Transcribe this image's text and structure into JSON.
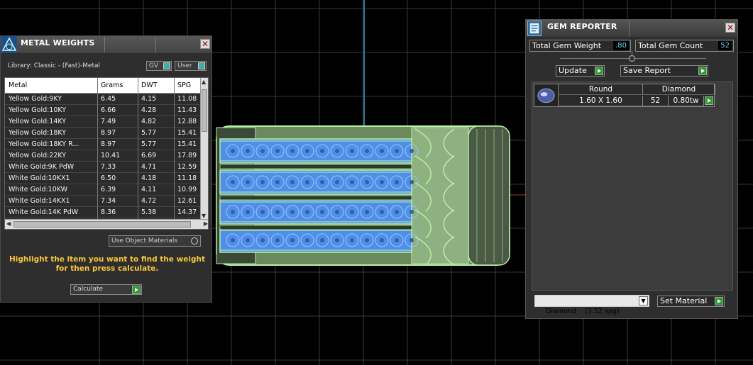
{
  "metal_weights": {
    "title": "METAL WEIGHTS",
    "library_label": "Library: Classic - (Fast)-Metal",
    "toggle_gv": "GV",
    "toggle_user": "User",
    "columns": [
      "Metal",
      "Grams",
      "DWT",
      "SPG"
    ],
    "rows": [
      [
        "Yellow Gold:9KY",
        "6.45",
        "4.15",
        "11.08"
      ],
      [
        "Yellow Gold:10KY",
        "6.66",
        "4.28",
        "11.43"
      ],
      [
        "Yellow Gold:14KY",
        "7.49",
        "4.82",
        "12.88"
      ],
      [
        "Yellow Gold:18KY",
        "8.97",
        "5.77",
        "15.41"
      ],
      [
        "Yellow Gold:18KY R...",
        "8.97",
        "5.77",
        "15.41"
      ],
      [
        "Yellow Gold:22KY",
        "10.41",
        "6.69",
        "17.89"
      ],
      [
        "White Gold:9K PdW",
        "7.33",
        "4.71",
        "12.59"
      ],
      [
        "White Gold:10KX1",
        "6.50",
        "4.18",
        "11.18"
      ],
      [
        "White Gold:10KW",
        "6.39",
        "4.11",
        "10.99"
      ],
      [
        "White Gold:14KX1",
        "7.34",
        "4.72",
        "12.61"
      ],
      [
        "White Gold:14K PdW",
        "8.36",
        "5.38",
        "14.37"
      ]
    ],
    "use_object_materials": "Use Object Materials",
    "hint": "Highlight the item you want to find the weight for then press calculate.",
    "calculate_label": "Calculate"
  },
  "gem_reporter": {
    "title": "GEM REPORTER",
    "total_weight_label": "Total Gem Weight",
    "total_weight_value": ".80",
    "total_count_label": "Total Gem Count",
    "total_count_value": "52",
    "update_label": "Update",
    "save_report_label": "Save Report",
    "gem_row": {
      "shape": "Round",
      "material": "Diamond",
      "size": "1.60 X 1.60",
      "count": "52",
      "weight": "0.80tw"
    },
    "material_select": "Diamond    (3.52 spg)",
    "set_material_label": "Set Material"
  },
  "colors": {
    "viewport_bg": "#000000",
    "grid_line": "#3a3a3a",
    "axis_line": "#2a7fa8",
    "ring_green": "#b8f0a8",
    "gem_blue": "#4f8fe8",
    "hint_yellow": "#f4c53c",
    "go_green": "#2a9a2a"
  },
  "icons": [
    "metal-weights-logo-icon",
    "gem-reporter-logo-icon",
    "close-icon",
    "go-arrow-icon",
    "dropdown-arrow-icon",
    "round-gem-icon"
  ]
}
